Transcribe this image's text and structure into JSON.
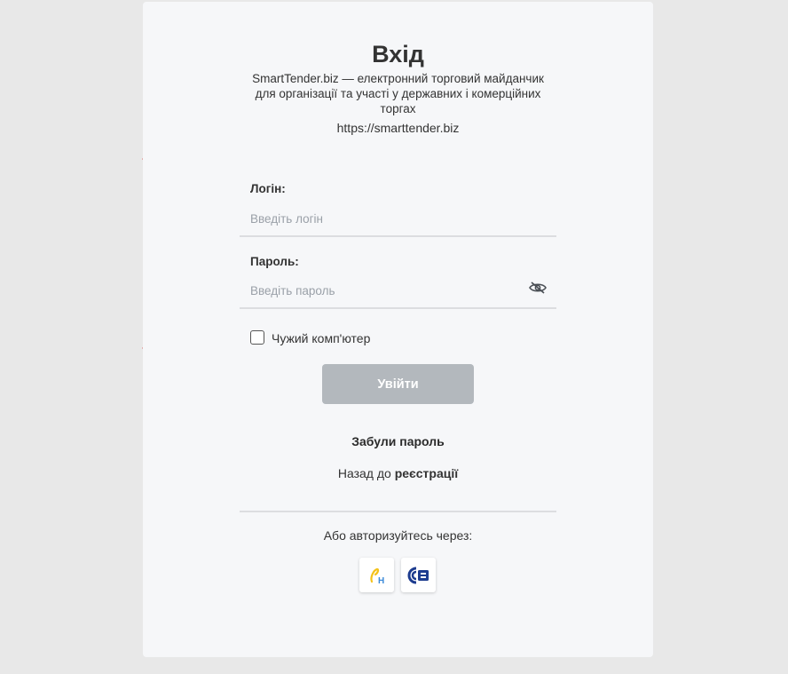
{
  "login_card": {
    "title": "Вхід",
    "subtitle": "SmartTender.biz — електронний торговий майданчик для організації та участі у державних і комерційних торгах",
    "site_url": "https://smarttender.biz"
  },
  "form": {
    "login_label": "Логін:",
    "login_placeholder": "Введіть логін",
    "login_value": "",
    "password_label": "Пароль:",
    "password_placeholder": "Введіть пароль",
    "password_value": "",
    "remember_label": "Чужий комп'ютер",
    "remember_checked": false,
    "submit_label": "Увійти",
    "submit_color": "#b3b8bd"
  },
  "links": {
    "forgot_password": "Забули пароль",
    "back_prefix": "Назад до",
    "registration": "реєстрації"
  },
  "alt_login": {
    "text": "Або авторизуйтесь через:",
    "providers": [
      {
        "icon": "diia-icon",
        "label": "Н"
      },
      {
        "icon": "eds-key-icon",
        "label": ""
      }
    ]
  },
  "annotations": {
    "arrow_color": "#d9403f"
  }
}
